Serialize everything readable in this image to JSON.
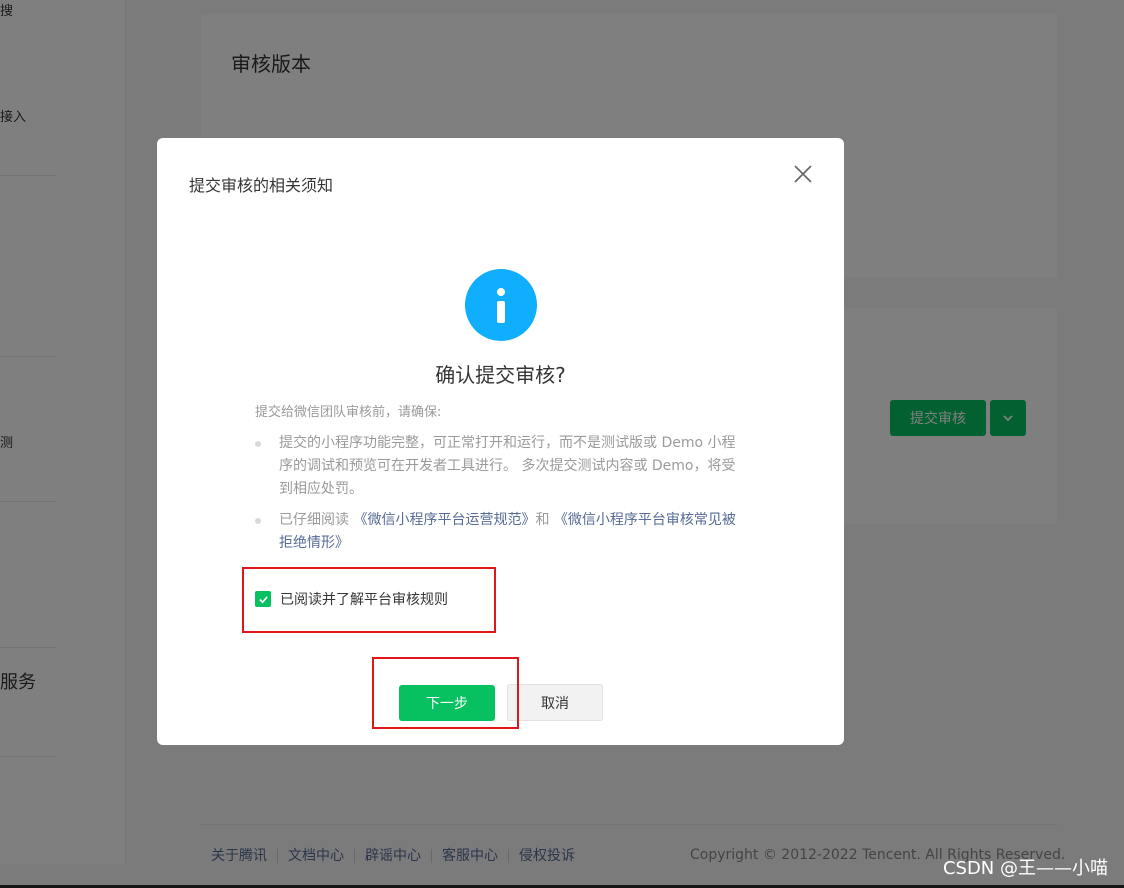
{
  "left_nav": {
    "fragments": [
      "搜",
      "接入",
      "测"
    ],
    "section_title": "服务"
  },
  "page": {
    "card_title": "审核版本",
    "submit_button": "提交审核",
    "dropdown_icon": "chevron-down-icon"
  },
  "footer": {
    "links": [
      "关于腾讯",
      "文档中心",
      "辟谣中心",
      "客服中心",
      "侵权投诉"
    ],
    "copyright": "Copyright © 2012-2022 Tencent. All Rights Reserved."
  },
  "watermark": "CSDN @王——小喵",
  "dialog": {
    "title": "提交审核的相关须知",
    "close_icon": "close-icon",
    "info_icon": "info-icon",
    "headline": "确认提交审核?",
    "intro": "提交给微信团队审核前，请确保:",
    "rule1": "提交的小程序功能完整，可正常打开和运行，而不是测试版或 Demo 小程序的调试和预览可在开发者工具进行。 多次提交测试内容或 Demo，将受到相应处罚。",
    "rule2_prefix": "已仔细阅读 ",
    "rule2_link1": "《微信小程序平台运营规范》",
    "rule2_mid": "和 ",
    "rule2_link2": "《微信小程序平台审核常见被拒绝情形》",
    "checkbox_label": "已阅读并了解平台审核规则",
    "checkbox_checked": true,
    "next_button": "下一步",
    "cancel_button": "取消"
  },
  "colors": {
    "accent": "#07c160",
    "info": "#10aeff",
    "link": "#576b95",
    "highlight": "#e0161b"
  }
}
